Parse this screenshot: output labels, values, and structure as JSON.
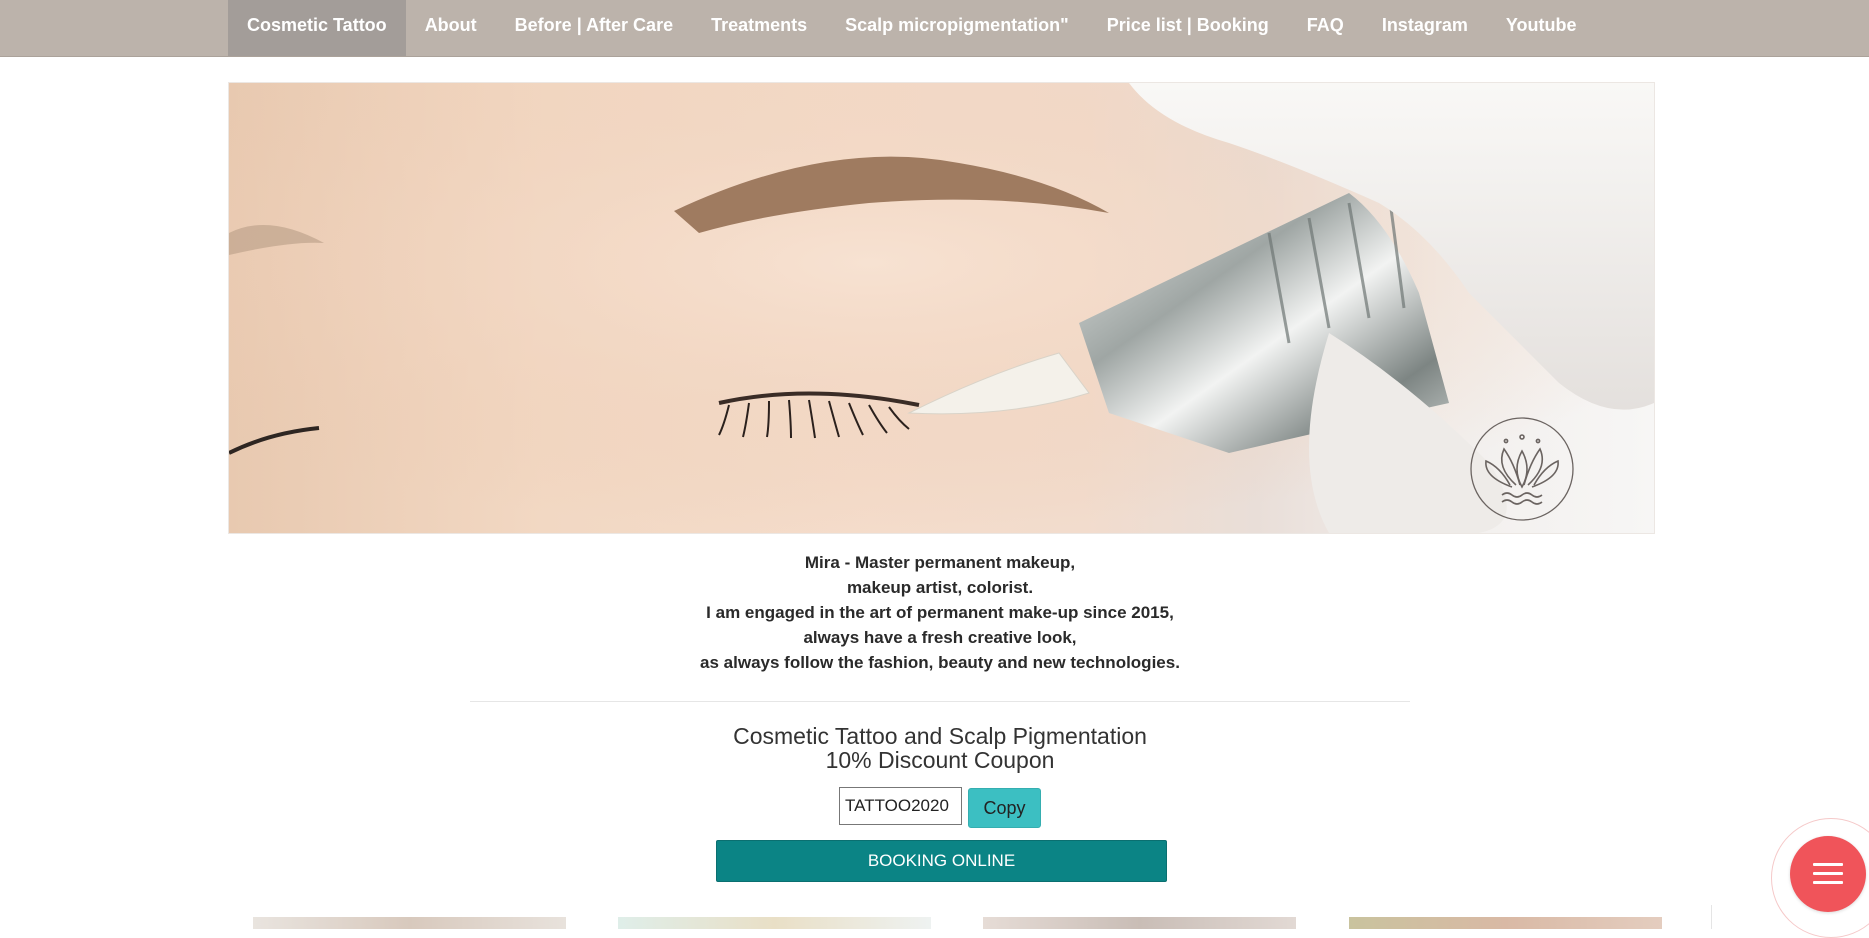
{
  "nav": {
    "items": [
      {
        "label": "Cosmetic Tattoo",
        "active": true
      },
      {
        "label": "About"
      },
      {
        "label": "Before | After Care"
      },
      {
        "label": "Treatments"
      },
      {
        "label": "Scalp micropigmentation\""
      },
      {
        "label": "Price list | Booking"
      },
      {
        "label": "FAQ"
      },
      {
        "label": "Instagram"
      },
      {
        "label": "Youtube"
      }
    ]
  },
  "hero": {
    "image": "closed-eye-permanent-makeup-machine-photo",
    "logo_icon": "lotus-logo-icon"
  },
  "bio": {
    "lines": [
      "Mira - Master permanent makeup,",
      "makeup artist, colorist.",
      "I am engaged in the art of permanent make-up since 2015,",
      "always have a fresh creative look,",
      "as always follow the fashion, beauty and new technologies."
    ]
  },
  "coupon": {
    "title_line1": "Cosmetic Tattoo and Scalp Pigmentation",
    "title_line2": "10% Discount Coupon",
    "code": "TATTOO2020",
    "copy_label": "Copy",
    "booking_label": "BOOKING ONLINE"
  },
  "colors": {
    "nav_bg": "#bcb3ab",
    "nav_active": "#a39d99",
    "copy_button": "#3cbfc2",
    "booking_button": "#0b8485",
    "menu_fab": "#f0545a"
  },
  "fab": {
    "icon": "hamburger-menu-icon"
  }
}
